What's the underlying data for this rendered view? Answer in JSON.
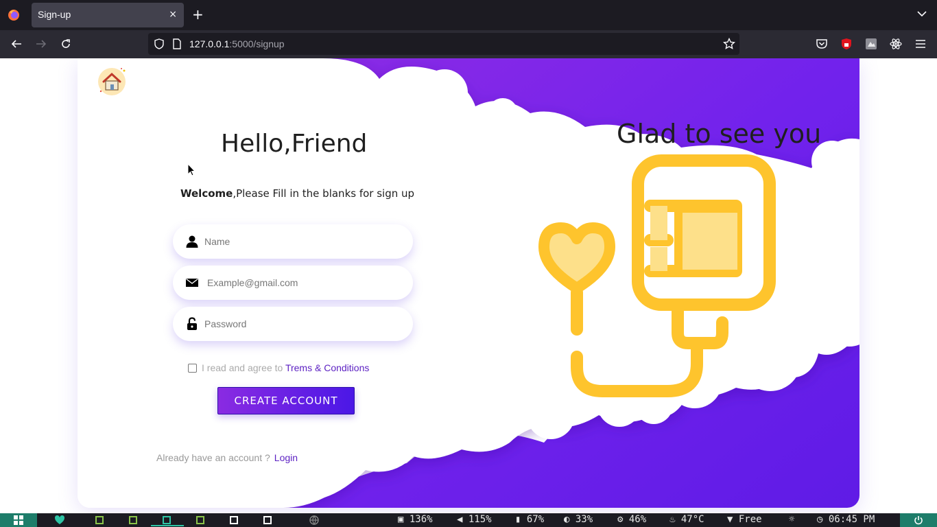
{
  "browser": {
    "tab_title": "Sign-up",
    "tab_close": "×",
    "new_tab": "+",
    "url_host": "127.0.0.1",
    "url_path": ":5000/signup"
  },
  "page": {
    "heading": "Hello,Friend",
    "welcome_bold": "Welcome",
    "welcome_rest": ",Please Fill in the blanks for sign up",
    "name_placeholder": "Name",
    "email_placeholder": "Example@gmail.com",
    "password_placeholder": "Password",
    "agree_text": "I read and agree to",
    "terms_link": "Trems & Conditions",
    "create_button": "CREATE ACCOUNT",
    "already_text": "Already have an account ?",
    "login_link": "Login",
    "glad_text": "Glad to see you"
  },
  "colors": {
    "accent": "#7b2ff0",
    "brand_gradient_start": "#8a2be2",
    "brand_gradient_end": "#4b17e6",
    "illustration": "#fec42d",
    "illustration_light": "#fde08a"
  },
  "taskbar": {
    "disk": "136%",
    "volume": "115%",
    "battery": "67%",
    "brightness": "33%",
    "cpu": "46%",
    "temp": "47°C",
    "wifi": "Free",
    "time": "06:45 PM"
  }
}
